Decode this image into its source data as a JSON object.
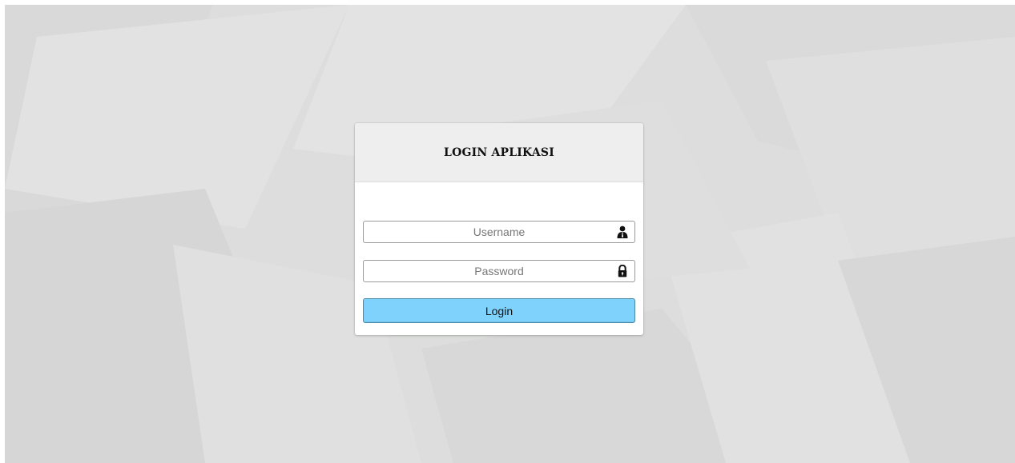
{
  "login": {
    "title": "LOGIN APLIKASI",
    "username_placeholder": "Username",
    "password_placeholder": "Password",
    "submit_label": "Login",
    "username_icon": "user-icon",
    "password_icon": "lock-icon"
  },
  "colors": {
    "background": "#dcdddc",
    "card_header": "#eeeeee",
    "button": "#7ed2fb"
  }
}
